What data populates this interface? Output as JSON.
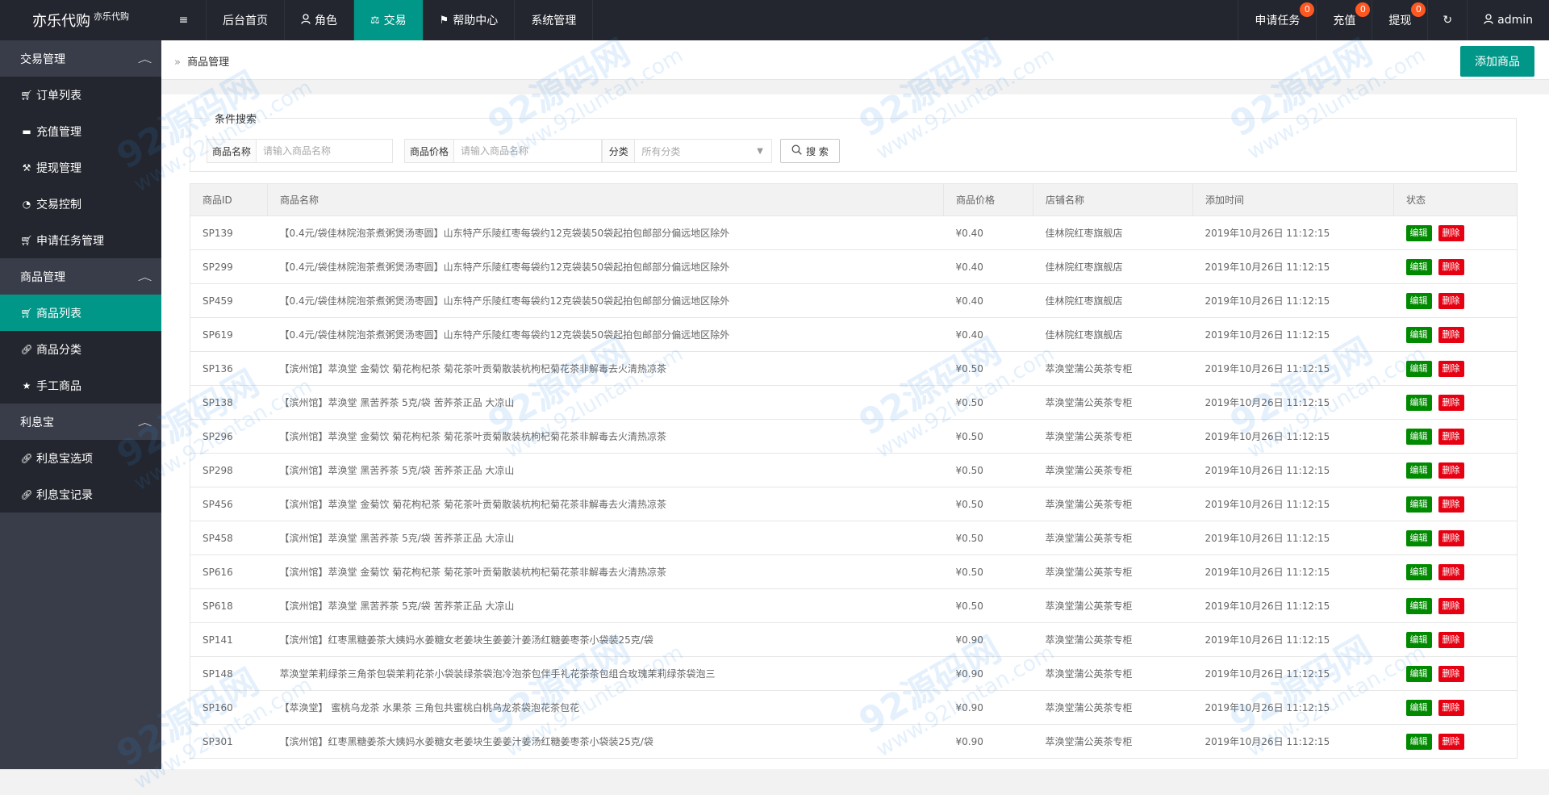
{
  "logo": {
    "name": "亦乐代购",
    "subtitle": "亦乐代购"
  },
  "topnav": {
    "menu_icon": "≡",
    "items": [
      {
        "label": "后台首页",
        "icon": ""
      },
      {
        "label": "角色",
        "icon": "person-icon"
      },
      {
        "label": "交易",
        "icon": "scale-icon"
      },
      {
        "label": "帮助中心",
        "icon": "flag-icon"
      },
      {
        "label": "系统管理",
        "icon": ""
      }
    ],
    "active_index": 2
  },
  "topright": {
    "apply": {
      "label": "申请任务",
      "badge": "0"
    },
    "recharge": {
      "label": "充值",
      "badge": "0"
    },
    "withdraw": {
      "label": "提现",
      "badge": "0"
    },
    "refresh_icon": "↻",
    "user": "admin"
  },
  "sidebar": {
    "groups": [
      {
        "label": "交易管理",
        "items": [
          {
            "label": "订单列表",
            "icon": "cart-icon"
          },
          {
            "label": "充值管理",
            "icon": "comment-icon"
          },
          {
            "label": "提现管理",
            "icon": "gavel-icon"
          },
          {
            "label": "交易控制",
            "icon": "dashboard-icon"
          },
          {
            "label": "申请任务管理",
            "icon": "cart-icon"
          }
        ]
      },
      {
        "label": "商品管理",
        "items": [
          {
            "label": "商品列表",
            "icon": "shopping-cart-icon"
          },
          {
            "label": "商品分类",
            "icon": "link-icon"
          },
          {
            "label": "手工商品",
            "icon": "star-icon"
          }
        ]
      },
      {
        "label": "利息宝",
        "items": [
          {
            "label": "利息宝选项",
            "icon": "link-icon"
          },
          {
            "label": "利息宝记录",
            "icon": "link-icon"
          }
        ]
      }
    ],
    "active": "商品列表"
  },
  "breadcrumb": {
    "current": "商品管理"
  },
  "add_button": "添加商品",
  "search": {
    "legend": "条件搜索",
    "name_label": "商品名称",
    "name_placeholder": "请输入商品名称",
    "price_label": "商品价格",
    "price_placeholder": "请输入商品名称",
    "category_label": "分类",
    "category_value": "所有分类",
    "button": "搜 索"
  },
  "table": {
    "columns": [
      "商品ID",
      "商品名称",
      "商品价格",
      "店铺名称",
      "添加时间",
      "状态"
    ],
    "edit_label": "编辑",
    "delete_label": "删除",
    "rows": [
      {
        "id": "SP139",
        "name": "【0.4元/袋佳林院泡茶煮粥煲汤枣圆】山东特产乐陵红枣每袋约12克袋装50袋起拍包邮部分偏远地区除外",
        "price": "¥0.40",
        "shop": "佳林院红枣旗舰店",
        "time": "2019年10月26日 11:12:15"
      },
      {
        "id": "SP299",
        "name": "【0.4元/袋佳林院泡茶煮粥煲汤枣圆】山东特产乐陵红枣每袋约12克袋装50袋起拍包邮部分偏远地区除外",
        "price": "¥0.40",
        "shop": "佳林院红枣旗舰店",
        "time": "2019年10月26日 11:12:15"
      },
      {
        "id": "SP459",
        "name": "【0.4元/袋佳林院泡茶煮粥煲汤枣圆】山东特产乐陵红枣每袋约12克袋装50袋起拍包邮部分偏远地区除外",
        "price": "¥0.40",
        "shop": "佳林院红枣旗舰店",
        "time": "2019年10月26日 11:12:15"
      },
      {
        "id": "SP619",
        "name": "【0.4元/袋佳林院泡茶煮粥煲汤枣圆】山东特产乐陵红枣每袋约12克袋装50袋起拍包邮部分偏远地区除外",
        "price": "¥0.40",
        "shop": "佳林院红枣旗舰店",
        "time": "2019年10月26日 11:12:15"
      },
      {
        "id": "SP136",
        "name": "【滨州馆】萃涣堂 金菊饮 菊花枸杞茶 菊花茶叶贡菊散装杭枸杞菊花茶非解毒去火清热凉茶",
        "price": "¥0.50",
        "shop": "萃涣堂蒲公英茶专柜",
        "time": "2019年10月26日 11:12:15"
      },
      {
        "id": "SP138",
        "name": "【滨州馆】萃涣堂 黑苦荞茶 5克/袋 苦荞茶正品 大凉山",
        "price": "¥0.50",
        "shop": "萃涣堂蒲公英茶专柜",
        "time": "2019年10月26日 11:12:15"
      },
      {
        "id": "SP296",
        "name": "【滨州馆】萃涣堂 金菊饮 菊花枸杞茶 菊花茶叶贡菊散装杭枸杞菊花茶非解毒去火清热凉茶",
        "price": "¥0.50",
        "shop": "萃涣堂蒲公英茶专柜",
        "time": "2019年10月26日 11:12:15"
      },
      {
        "id": "SP298",
        "name": "【滨州馆】萃涣堂 黑苦荞茶 5克/袋 苦荞茶正品 大凉山",
        "price": "¥0.50",
        "shop": "萃涣堂蒲公英茶专柜",
        "time": "2019年10月26日 11:12:15"
      },
      {
        "id": "SP456",
        "name": "【滨州馆】萃涣堂 金菊饮 菊花枸杞茶 菊花茶叶贡菊散装杭枸杞菊花茶非解毒去火清热凉茶",
        "price": "¥0.50",
        "shop": "萃涣堂蒲公英茶专柜",
        "time": "2019年10月26日 11:12:15"
      },
      {
        "id": "SP458",
        "name": "【滨州馆】萃涣堂 黑苦荞茶 5克/袋 苦荞茶正品 大凉山",
        "price": "¥0.50",
        "shop": "萃涣堂蒲公英茶专柜",
        "time": "2019年10月26日 11:12:15"
      },
      {
        "id": "SP616",
        "name": "【滨州馆】萃涣堂 金菊饮 菊花枸杞茶 菊花茶叶贡菊散装杭枸杞菊花茶非解毒去火清热凉茶",
        "price": "¥0.50",
        "shop": "萃涣堂蒲公英茶专柜",
        "time": "2019年10月26日 11:12:15"
      },
      {
        "id": "SP618",
        "name": "【滨州馆】萃涣堂 黑苦荞茶 5克/袋 苦荞茶正品 大凉山",
        "price": "¥0.50",
        "shop": "萃涣堂蒲公英茶专柜",
        "time": "2019年10月26日 11:12:15"
      },
      {
        "id": "SP141",
        "name": "【滨州馆】红枣黑糖姜茶大姨妈水姜糖女老姜块生姜姜汁姜汤红糖姜枣茶小袋装25克/袋",
        "price": "¥0.90",
        "shop": "萃涣堂蒲公英茶专柜",
        "time": "2019年10月26日 11:12:15"
      },
      {
        "id": "SP148",
        "name": "萃涣堂茉莉绿茶三角茶包袋茉莉花茶小袋装绿茶袋泡冷泡茶包伴手礼花茶茶包组合玫瑰茉莉绿茶袋泡三",
        "price": "¥0.90",
        "shop": "萃涣堂蒲公英茶专柜",
        "time": "2019年10月26日 11:12:15"
      },
      {
        "id": "SP160",
        "name": "【萃涣堂】 蜜桃乌龙茶 水果茶 三角包共蜜桃白桃乌龙茶袋泡花茶包花",
        "price": "¥0.90",
        "shop": "萃涣堂蒲公英茶专柜",
        "time": "2019年10月26日 11:12:15"
      },
      {
        "id": "SP301",
        "name": "【滨州馆】红枣黑糖姜茶大姨妈水姜糖女老姜块生姜姜汁姜汤红糖姜枣茶小袋装25克/袋",
        "price": "¥0.90",
        "shop": "萃涣堂蒲公英茶专柜",
        "time": "2019年10月26日 11:12:15"
      }
    ]
  },
  "watermark": {
    "main": "92源码网",
    "url": "www.92luntan.com"
  }
}
